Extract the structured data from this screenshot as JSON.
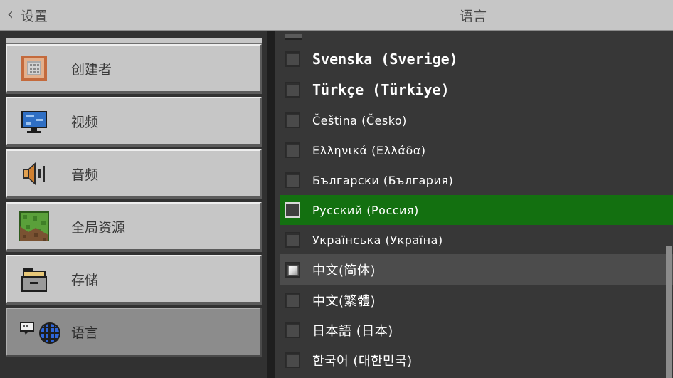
{
  "header": {
    "back_label": "设置",
    "title": "语言"
  },
  "sidebar": {
    "items": [
      {
        "label": "创建者",
        "icon": "command-block-icon"
      },
      {
        "label": "视频",
        "icon": "monitor-icon"
      },
      {
        "label": "音频",
        "icon": "speaker-icon"
      },
      {
        "label": "全局资源",
        "icon": "grass-block-icon"
      },
      {
        "label": "存储",
        "icon": "storage-folder-icon"
      },
      {
        "label": "语言",
        "icon": "language-globe-icon",
        "selected": true
      }
    ]
  },
  "languages": [
    {
      "label": "Svenska (Sverige)"
    },
    {
      "label": "Türkçe (Türkiye)"
    },
    {
      "label": "Čeština (Česko)"
    },
    {
      "label": "Ελληνικά (Ελλάδα)"
    },
    {
      "label": "Български (България)"
    },
    {
      "label": "Русский (Россия)",
      "state": "highlighted"
    },
    {
      "label": "Українська (Україна)"
    },
    {
      "label": "中文(简体)",
      "state": "checked"
    },
    {
      "label": "中文(繁體)"
    },
    {
      "label": "日本語 (日本)"
    },
    {
      "label": "한국어 (대한민국)"
    }
  ],
  "colors": {
    "highlight": "#137010",
    "header_bg": "#c6c6c6",
    "panel_bg": "#373737"
  }
}
